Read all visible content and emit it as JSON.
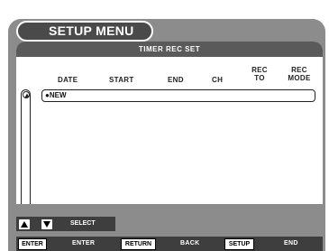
{
  "menu_title": "SETUP MENU",
  "panel_title": "TIMER REC SET",
  "columns": {
    "date": "DATE",
    "start": "START",
    "end": "END",
    "ch": "CH",
    "rec_to_1": "REC",
    "rec_to_2": "TO",
    "rec_mode_1": "REC",
    "rec_mode_2": "MODE"
  },
  "rows": [
    {
      "label": "●NEW"
    }
  ],
  "select_hint": "SELECT",
  "keys": [
    {
      "key": "ENTER",
      "action": "ENTER"
    },
    {
      "key": "RETURN",
      "action": "BACK"
    },
    {
      "key": "SETUP",
      "action": "END"
    }
  ],
  "icons": {
    "up": "triangle-up",
    "down": "triangle-down"
  }
}
